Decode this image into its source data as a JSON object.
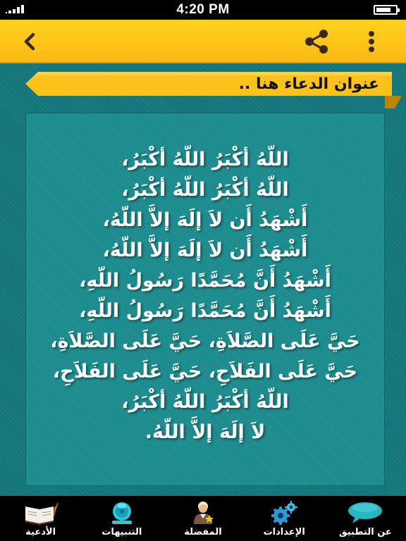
{
  "status_bar": {
    "time": "4:20 PM"
  },
  "title": "عنوان الدعاء هنا ..",
  "prayer_lines": [
    "اللّهُ أكْبَرُ اللّهُ أكْبَرُ،",
    "اللّهُ أكْبَرُ اللّهُ أكْبَرُ،",
    "أَشْهَدُ أَن لاَ إلَهَ إلاَّ اللّهُ،",
    "أَشْهَدُ أَن لاَ إلَهَ إلاَّ اللّهُ،",
    "أَشْهَدُ أَنَّ مُحَمَّدًا رَسُولُ اللّهِ،",
    "أَشْهَدُ أَنَّ مُحَمَّدًا رَسُولُ اللّهِ،",
    "حَيَّ عَلَى الصَّلاَةِ، حَيَّ عَلَى الصَّلاَةِ،",
    "حَيَّ عَلَى الفَلاَحِ، حَيَّ عَلَى الفَلاَحِ،",
    "اللّهُ أكْبَرُ اللّهُ أكْبَرُ،",
    "لاَ إلَهَ إلاَّ اللّهُ."
  ],
  "tabs": [
    {
      "label": "الأدعية",
      "icon": "book-icon"
    },
    {
      "label": "التنبيهات",
      "icon": "bell-icon"
    },
    {
      "label": "المفضلة",
      "icon": "favorite-person-icon"
    },
    {
      "label": "الإعدادات",
      "icon": "gears-icon"
    },
    {
      "label": "عن التطبيق",
      "icon": "speech-bubble-icon"
    }
  ],
  "colors": {
    "app_bar": "#fcc418",
    "background": "#14757a",
    "card": "#1b8b8e",
    "tab_bar": "#000000",
    "text": "#ffffff"
  }
}
